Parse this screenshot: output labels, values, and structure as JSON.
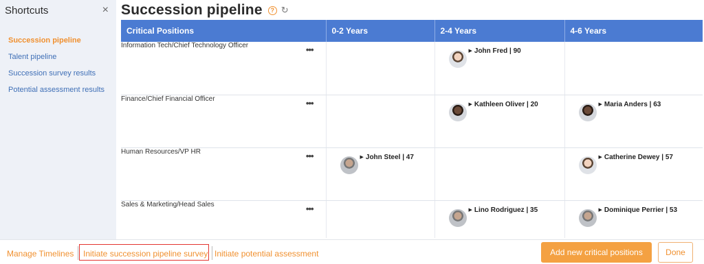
{
  "sidebar": {
    "title": "Shortcuts",
    "close_glyph": "×",
    "items": [
      {
        "label": "Succession pipeline",
        "active": true
      },
      {
        "label": "Talent pipeline"
      },
      {
        "label": "Succession survey results"
      },
      {
        "label": "Potential assessment results"
      }
    ]
  },
  "header": {
    "title": "Succession pipeline",
    "help_glyph": "?",
    "refresh_glyph": "↻",
    "icons": [
      "help-icon",
      "refresh-icon"
    ]
  },
  "table": {
    "columns": [
      "Critical Positions",
      "0-2 Years",
      "2-4 Years",
      "4-6 Years"
    ],
    "menu_glyph": "•••",
    "caret_glyph": "▶",
    "rows": [
      {
        "position": "Information Tech/Chief Technology Officer",
        "y02": "",
        "y24": "John Fred | 90",
        "y46": ""
      },
      {
        "position": "Finance/Chief Financial Officer",
        "y02": "",
        "y24": "Kathleen Oliver | 20",
        "y46": "Maria Anders | 63"
      },
      {
        "position": "Human Resources/VP HR",
        "y02": "John Steel | 47",
        "y24": "",
        "y46": "Catherine Dewey | 57"
      },
      {
        "position": "Sales & Marketing/Head Sales",
        "y02": "",
        "y24": "Lino Rodriguez | 35",
        "y46": "Dominique Perrier | 53"
      }
    ]
  },
  "footer": {
    "manage_timelines": "Manage Timelines",
    "initiate_survey": "Initiate succession pipeline survey",
    "initiate_assessment": "Initiate potential assessment",
    "add_positions": "Add new critical positions",
    "done": "Done"
  },
  "colors": {
    "accent": "#f0902f",
    "header_blue": "#4b7bd2",
    "link_blue": "#3f6fb6",
    "highlight_red": "#e3342f"
  }
}
